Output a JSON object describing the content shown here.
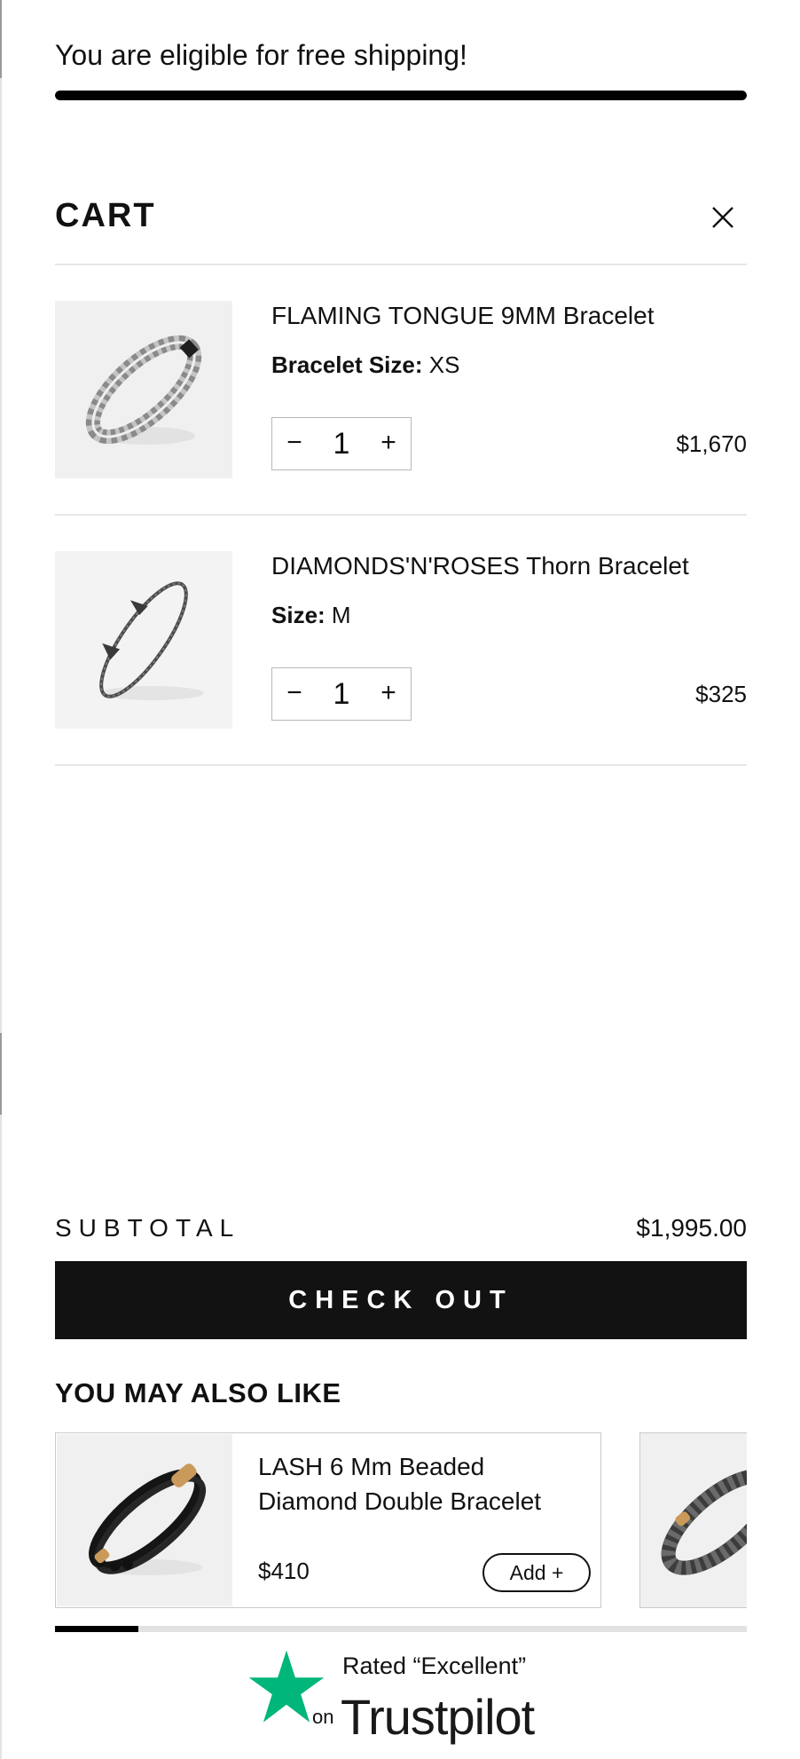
{
  "shipping": {
    "message": "You are eligible for free shipping!",
    "progress": 1.0
  },
  "cart": {
    "title": "CART",
    "close_icon": "close-icon",
    "items": [
      {
        "name": "FLAMING TONGUE 9MM Bracelet",
        "variant_label": "Bracelet Size:",
        "variant_value": "XS",
        "quantity": "1",
        "minus_label": "−",
        "plus_label": "+",
        "price": "$1,670"
      },
      {
        "name": "DIAMONDS'N'ROSES Thorn Bracelet",
        "variant_label": "Size:",
        "variant_value": "M",
        "quantity": "1",
        "minus_label": "−",
        "plus_label": "+",
        "price": "$325"
      }
    ]
  },
  "summary": {
    "subtotal_label": "SUBTOTAL",
    "subtotal_value": "$1,995.00",
    "checkout_label": "CHECK OUT"
  },
  "recommendations": {
    "title": "YOU MAY ALSO LIKE",
    "items": [
      {
        "name": "LASH 6 Mm Beaded Diamond Double Bracelet",
        "price": "$410",
        "add_label": "Add +"
      }
    ],
    "carousel_progress": 0.12
  },
  "trustpilot": {
    "rated_text": "Rated “Excellent”",
    "on_text": "on",
    "brand": "Trustpilot",
    "star_color": "#00b67a"
  },
  "colors": {
    "text": "#111111",
    "checkout_bg": "#121212",
    "divider": "#e6e6e6",
    "image_bg": "#f0f0f0"
  }
}
